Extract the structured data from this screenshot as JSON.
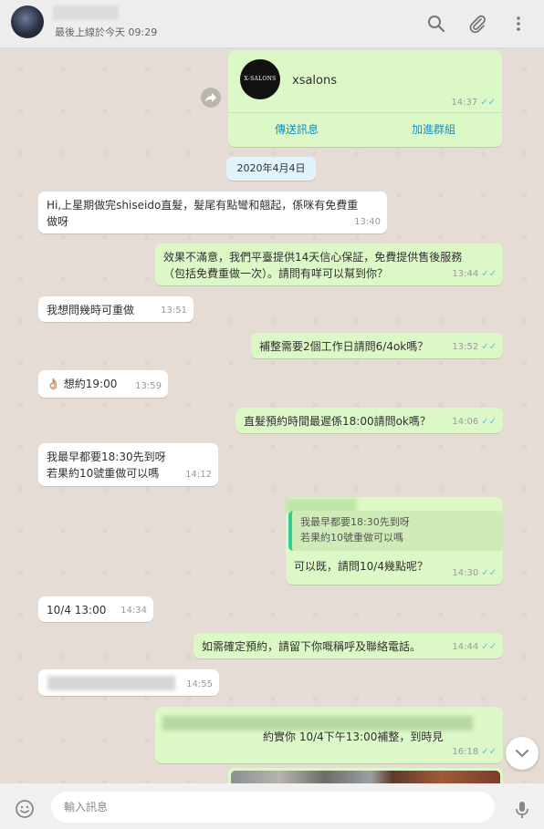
{
  "header": {
    "last_seen": "最後上線於今天 09:29",
    "icons": [
      "search-icon",
      "attach-icon",
      "menu-icon"
    ]
  },
  "contact_card": {
    "logo_text": "X-SALONS",
    "name": "xsalons",
    "time": "14:37",
    "send_message": "傳送訊息",
    "add_group": "加進群組"
  },
  "date_chip": "2020年4月4日",
  "messages": [
    {
      "dir": "in",
      "text": "Hi,上星期做完shiseido直髮，髮尾有點彎和翹起，係咪有免費重\n做呀",
      "time": "13:40"
    },
    {
      "dir": "out",
      "text": "效果不滿意，我們平臺提供14天信心保証，免費提供售後服務\n（包括免費重做一次）。請問有咩可以幫到你？",
      "time": "13:44"
    },
    {
      "dir": "in",
      "text": "我想問幾時可重做",
      "time": "13:51"
    },
    {
      "dir": "out",
      "text": "補整需要2個工作日請問6/4ok嗎？",
      "time": "13:52"
    },
    {
      "dir": "in",
      "text": "👌🏼 想約19:00",
      "time": "13:59"
    },
    {
      "dir": "out",
      "text": "直髮預約時間最遲係18:00請問ok嗎？",
      "time": "14:06"
    },
    {
      "dir": "in",
      "text": "我最早都要18:30先到呀\n若果約10號重做可以嗎",
      "time": "14:12"
    },
    {
      "dir": "out",
      "quote": "我最早都要18:30先到呀\n若果約10號重做可以嗎",
      "text": "可以既，請問10/4幾點呢？",
      "time": "14:30"
    },
    {
      "dir": "in",
      "text": "10/4 13:00",
      "time": "14:34"
    },
    {
      "dir": "out",
      "text": "如需確定預約，請留下你嘅稱呼及聯絡電話。",
      "time": "14:44"
    },
    {
      "dir": "in",
      "text": "",
      "time": "14:55"
    },
    {
      "dir": "out",
      "text": "約實你 10/4下午13:00補整，到時見",
      "time": "16:18"
    }
  ],
  "footer": {
    "placeholder": "輸入訊息"
  },
  "colors": {
    "incoming": "#ffffff",
    "outgoing": "#dcf8c6",
    "ticks": "#4fc3f7",
    "link": "#1a8fbf",
    "background": "#e5ddd5"
  }
}
